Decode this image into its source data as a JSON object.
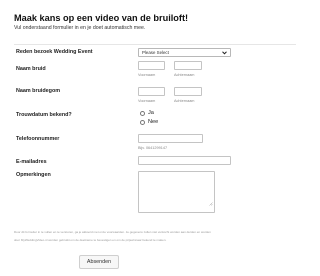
{
  "header": {
    "title": "Maak kans op een video van de bruiloft!",
    "subtitle": "Vul onderstaand formulier in en je doet automatisch mee."
  },
  "form": {
    "event": {
      "label": "Reden bezoek Wedding Event",
      "selected": "Please Select"
    },
    "bride": {
      "label": "Naam bruid",
      "first_sublabel": "Voornaam",
      "last_sublabel": "Achternaam"
    },
    "groom": {
      "label": "Naam bruidegom",
      "first_sublabel": "Voornaam",
      "last_sublabel": "Achternaam"
    },
    "date_known": {
      "label": "Trouwdatum bekend?",
      "options": [
        "Ja",
        "Nee"
      ]
    },
    "phone": {
      "label": "Telefoonnummer",
      "hint": "Bijv. 0641299147"
    },
    "email": {
      "label": "E-mailadres"
    },
    "remarks": {
      "label": "Opmerkingen"
    }
  },
  "disclaimer": {
    "line1": "Door dit formulier in te vullen en te versturen, ga je akkoord met onze voorwaarden. Je gegevens zullen niet verkocht worden aan derden en worden",
    "line2": "door MyWeddingVideo.nl worden gebruikt om de deelname te bevestigen en om de prijswinnaar bekend te maken."
  },
  "submit": {
    "label": "Absenden"
  },
  "icons": {
    "select_arrow": "chevron-down-icon",
    "textarea_resize": "resize-handle-icon"
  }
}
